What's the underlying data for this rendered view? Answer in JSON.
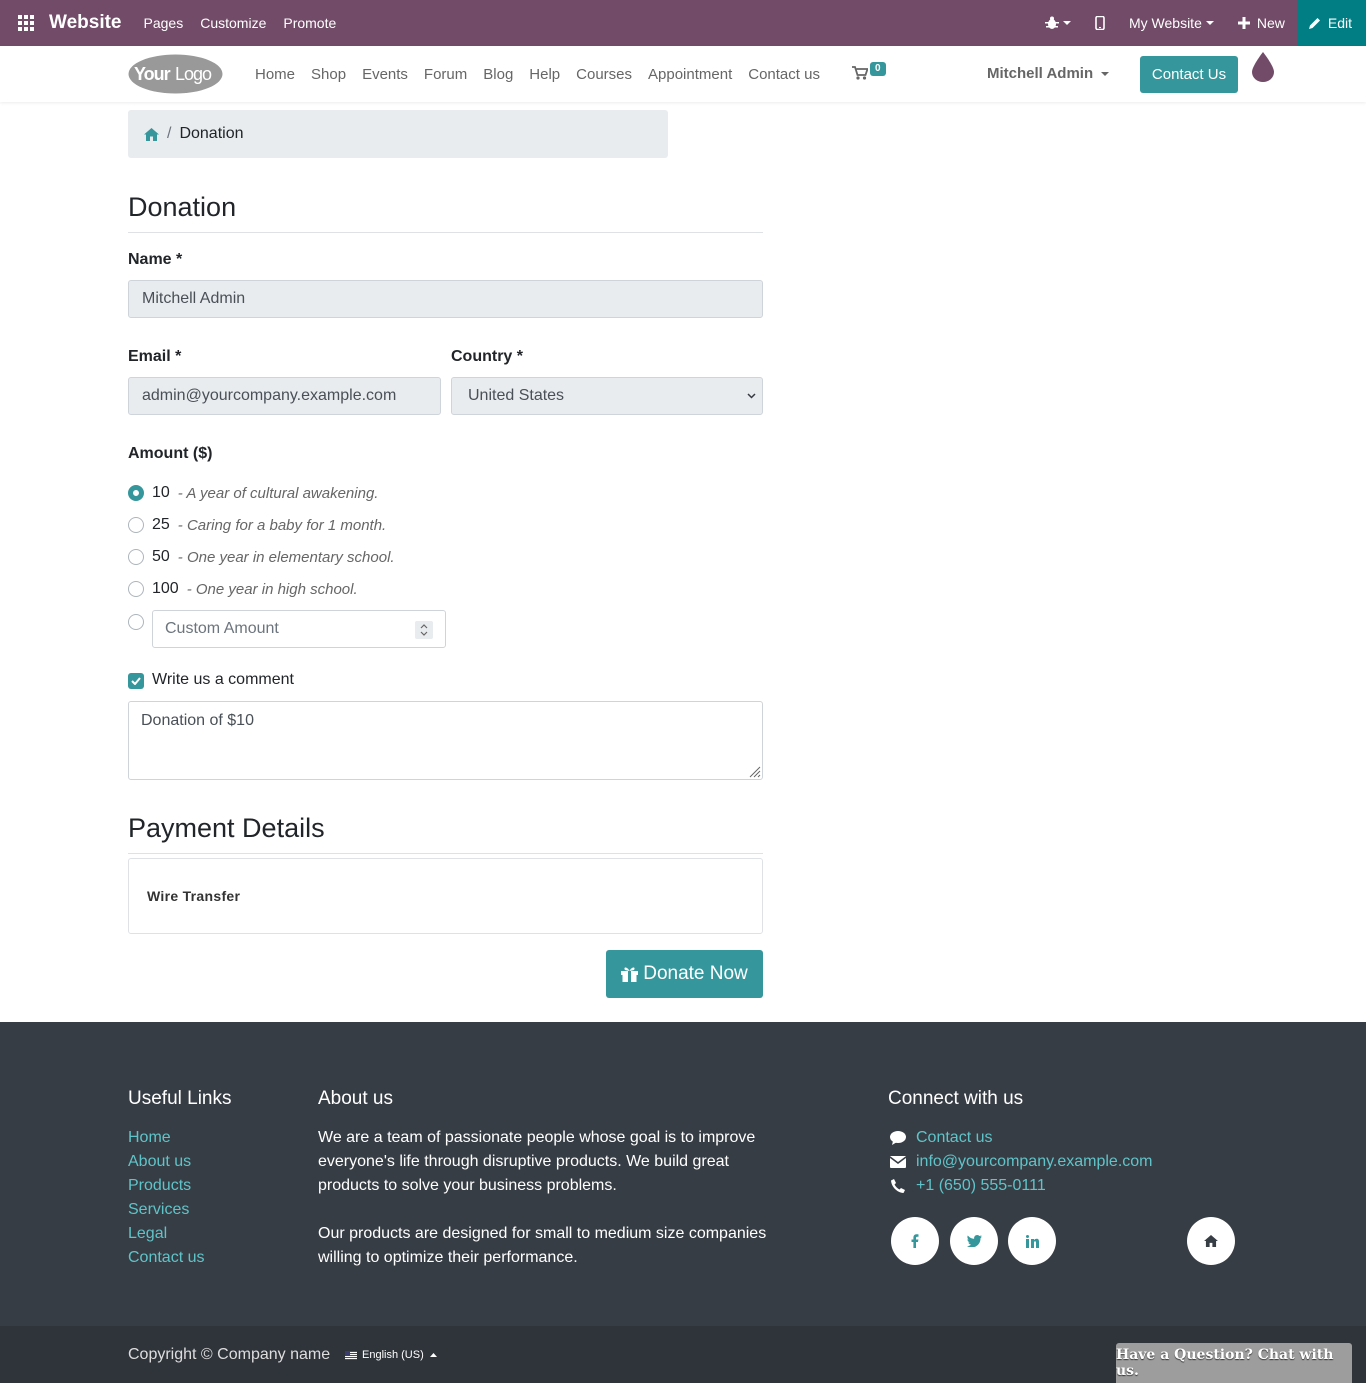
{
  "topbar": {
    "brand": "Website",
    "menus": [
      "Pages",
      "Customize",
      "Promote"
    ],
    "site": "My Website",
    "new_label": "New",
    "edit_label": "Edit",
    "color": "#714b67"
  },
  "nav": {
    "links": [
      "Home",
      "Shop",
      "Events",
      "Forum",
      "Blog",
      "Help",
      "Courses",
      "Appointment",
      "Contact us"
    ],
    "cart_count": "0",
    "user": "Mitchell Admin",
    "contact_btn": "Contact Us",
    "logo_text": "YourLogo"
  },
  "breadcrumb": {
    "current": "Donation"
  },
  "form": {
    "title": "Donation",
    "name_label": "Name *",
    "name_value": "Mitchell Admin",
    "email_label": "Email *",
    "email_value": "admin@yourcompany.example.com",
    "country_label": "Country *",
    "country_value": "United States",
    "amount_label": "Amount ($)",
    "amounts": [
      {
        "value": "10",
        "desc": "- A year of cultural awakening.",
        "selected": true
      },
      {
        "value": "25",
        "desc": "- Caring for a baby for 1 month.",
        "selected": false
      },
      {
        "value": "50",
        "desc": "- One year in elementary school.",
        "selected": false
      },
      {
        "value": "100",
        "desc": "- One year in high school.",
        "selected": false
      }
    ],
    "custom_placeholder": "Custom Amount",
    "comment_label": "Write us a comment",
    "comment_value": "Donation of $10",
    "payment_title": "Payment Details",
    "payment_method": "Wire Transfer",
    "donate_label": "Donate Now"
  },
  "footer": {
    "useful_title": "Useful Links",
    "useful_links": [
      "Home",
      "About us",
      "Products",
      "Services",
      "Legal",
      "Contact us"
    ],
    "about_title": "About us",
    "about_p1": "We are a team of passionate people whose goal is to improve everyone's life through disruptive products. We build great products to solve your business problems.",
    "about_p2": "Our products are designed for small to medium size companies willing to optimize their performance.",
    "connect_title": "Connect with us",
    "contact_link": "Contact us",
    "email": "info@yourcompany.example.com",
    "phone": "+1 (650) 555-0111",
    "copyright": "Copyright © Company name",
    "language": "English (US)",
    "chat": "Have a Question? Chat with us."
  },
  "colors": {
    "accent": "#35979c",
    "footer_bg": "#373d45",
    "link": "#5fc4c9"
  }
}
